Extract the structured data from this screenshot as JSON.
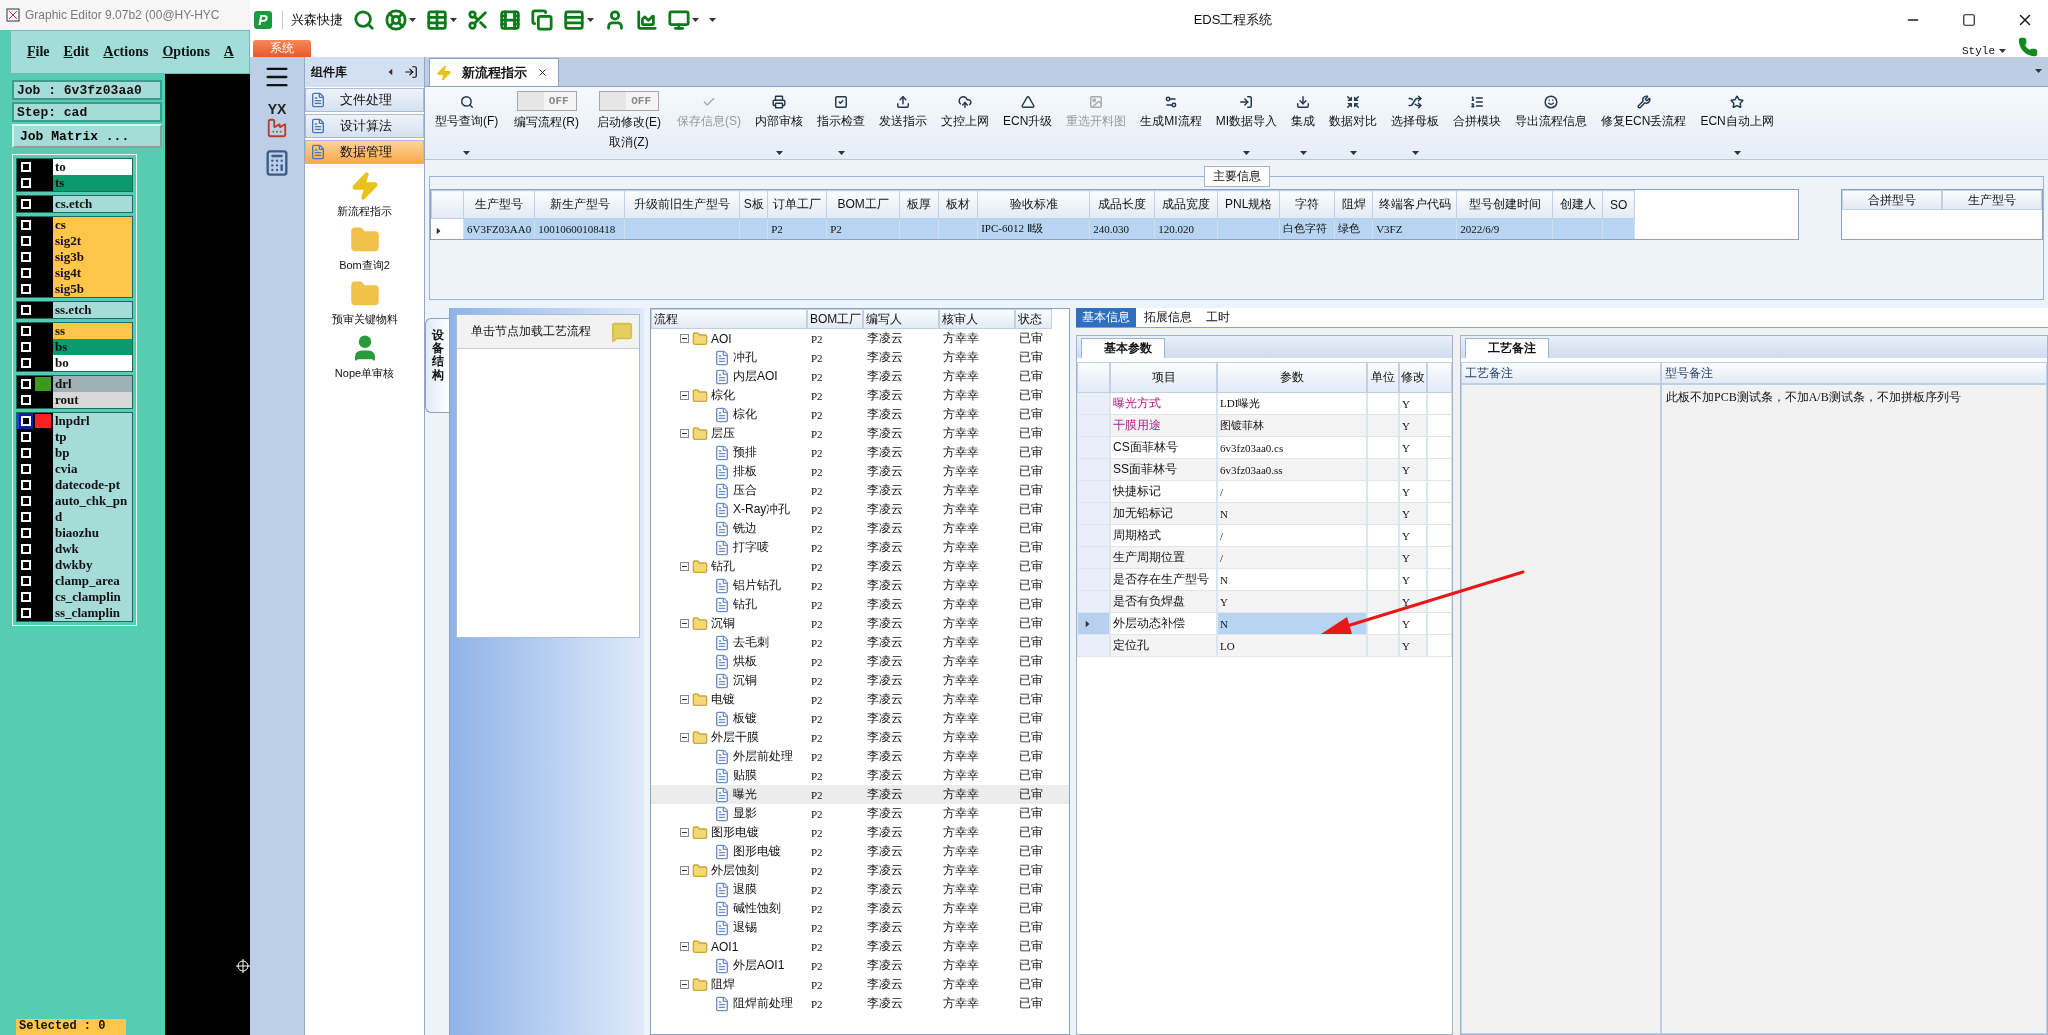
{
  "editor": {
    "title": "Graphic Editor 9.07b2 (00@HY-HYC",
    "menu": [
      "File",
      "Edit",
      "Actions",
      "Options",
      "A"
    ],
    "job": "Job : 6v3fz03aa0",
    "step": "Step: cad",
    "matrix_button": "Job Matrix ...",
    "status": "Selected : 0",
    "layer_groups": [
      [
        {
          "name": "to",
          "color": "#ffffff",
          "active": false
        },
        {
          "name": "ts",
          "color": "#0b9a6c",
          "active": false
        }
      ],
      [
        {
          "name": "cs.etch",
          "color": "#a6dcd8",
          "active": false
        }
      ],
      [
        {
          "name": "cs",
          "color": "#ffc64a",
          "active": false
        },
        {
          "name": "sig2t",
          "color": "#ffc64a",
          "active": false
        },
        {
          "name": "sig3b",
          "color": "#ffc64a",
          "active": false
        },
        {
          "name": "sig4t",
          "color": "#ffc64a",
          "active": false
        },
        {
          "name": "sig5b",
          "color": "#ffc64a",
          "active": false
        }
      ],
      [
        {
          "name": "ss.etch",
          "color": "#a6dcd8",
          "active": false
        }
      ],
      [
        {
          "name": "ss",
          "color": "#ffc64a",
          "active": false
        },
        {
          "name": "bs",
          "color": "#0b9a6c",
          "active": false
        },
        {
          "name": "bo",
          "color": "#ffffff",
          "active": false
        }
      ],
      [
        {
          "name": "drl",
          "color": "#9fb1b5",
          "marker": {
            "color": "#3c9a1c"
          },
          "active": false
        },
        {
          "name": "rout",
          "color": "#d9d9d9",
          "active": false
        }
      ],
      [
        {
          "name": "lnpdrl",
          "color": "#a6dcd8",
          "marker": {
            "color": "#ff2020"
          },
          "active": true
        },
        {
          "name": "tp",
          "color": "#a6dcd8",
          "active": false
        },
        {
          "name": "bp",
          "color": "#a6dcd8",
          "active": false
        },
        {
          "name": "cvia",
          "color": "#a6dcd8",
          "active": false
        },
        {
          "name": "datecode-pt",
          "color": "#a6dcd8",
          "active": false
        },
        {
          "name": "auto_chk_pn",
          "color": "#a6dcd8",
          "active": false
        },
        {
          "name": "d",
          "color": "#a6dcd8",
          "active": false
        },
        {
          "name": "biaozhu",
          "color": "#a6dcd8",
          "active": false
        },
        {
          "name": "dwk",
          "color": "#a6dcd8",
          "active": false
        },
        {
          "name": "dwkby",
          "color": "#a6dcd8",
          "active": false
        },
        {
          "name": "clamp_area",
          "color": "#a6dcd8",
          "active": false
        },
        {
          "name": "cs_clamplin",
          "color": "#a6dcd8",
          "active": false
        },
        {
          "name": "ss_clamplin",
          "color": "#a6dcd8",
          "active": false
        }
      ]
    ]
  },
  "app": {
    "logo": "P",
    "brand": "兴森快捷",
    "title": "EDS工程系统",
    "menu_tab": "系统",
    "style": "Style",
    "strip_logo": "YX"
  },
  "sidebar": {
    "title": "组件库",
    "sections": [
      {
        "label": "文件处理",
        "selected": false
      },
      {
        "label": "设计算法",
        "selected": false
      },
      {
        "label": "数据管理",
        "selected": true
      }
    ],
    "items": [
      {
        "label": "新流程指示",
        "kind": "flash"
      },
      {
        "label": "Bom查询2",
        "kind": "folder"
      },
      {
        "label": "预审关键物料",
        "kind": "folder"
      },
      {
        "label": "Nope单审核",
        "kind": "user"
      }
    ]
  },
  "doc_tab": {
    "label": "新流程指示"
  },
  "toolbar": [
    {
      "kind": "button",
      "label": "型号查询(F)",
      "dropdown": true,
      "disabled": false
    },
    {
      "kind": "toggle",
      "label": "编写流程(R)",
      "switch": "OFF",
      "on": false
    },
    {
      "kind": "toggle",
      "label": "启动修改(E)",
      "sublabel": "取消(Z)",
      "switch": "OFF",
      "on": false
    },
    {
      "kind": "button",
      "label": "保存信息(S)",
      "dropdown": false,
      "disabled": true
    },
    {
      "kind": "button",
      "label": "内部审核",
      "dropdown": true,
      "disabled": false
    },
    {
      "kind": "button",
      "label": "指示检查",
      "dropdown": true,
      "disabled": false
    },
    {
      "kind": "button",
      "label": "发送指示",
      "dropdown": false,
      "disabled": false
    },
    {
      "kind": "button",
      "label": "文控上网",
      "dropdown": false,
      "disabled": false
    },
    {
      "kind": "button",
      "label": "ECN升级",
      "dropdown": false,
      "disabled": false
    },
    {
      "kind": "button",
      "label": "重选开料图",
      "dropdown": false,
      "disabled": true
    },
    {
      "kind": "button",
      "label": "生成MI流程",
      "dropdown": false,
      "disabled": false
    },
    {
      "kind": "button",
      "label": "MI数据导入",
      "dropdown": true,
      "disabled": false
    },
    {
      "kind": "button",
      "label": "集成",
      "dropdown": true,
      "disabled": false
    },
    {
      "kind": "button",
      "label": "数据对比",
      "dropdown": true,
      "disabled": false
    },
    {
      "kind": "button",
      "label": "选择母板",
      "dropdown": true,
      "disabled": false
    },
    {
      "kind": "button",
      "label": "合拼模块",
      "dropdown": false,
      "disabled": false
    },
    {
      "kind": "button",
      "label": "导出流程信息",
      "dropdown": false,
      "disabled": false
    },
    {
      "kind": "button",
      "label": "修复ECN丢流程",
      "dropdown": false,
      "disabled": false
    },
    {
      "kind": "button",
      "label": "ECN自动上网",
      "dropdown": true,
      "disabled": false
    }
  ],
  "main_info": {
    "title": "主要信息",
    "row_selected": true,
    "side_columns": [
      "合拼型号",
      "生产型号"
    ],
    "columns": [
      {
        "label": "生产型号",
        "value": "6V3FZ03AA0"
      },
      {
        "label": "新生产型号",
        "value": "10010600108418"
      },
      {
        "label": "升级前旧生产型号"
      },
      {
        "label": "S板"
      },
      {
        "label": "订单工厂",
        "value": "P2"
      },
      {
        "label": "BOM工厂",
        "value": "P2"
      },
      {
        "label": "板厚"
      },
      {
        "label": "板材"
      },
      {
        "label": "验收标准",
        "value": "IPC-6012 Ⅱ级"
      },
      {
        "label": "成品长度",
        "value": "240.030"
      },
      {
        "label": "成品宽度",
        "value": "120.020"
      },
      {
        "label": "PNL规格"
      },
      {
        "label": "字符",
        "value": "白色字符"
      },
      {
        "label": "阻焊",
        "value": "绿色"
      },
      {
        "label": "终端客户代码",
        "value": "V3FZ"
      },
      {
        "label": "型号创建时间",
        "value": "2022/6/9"
      },
      {
        "label": "创建人"
      },
      {
        "label": "SO"
      }
    ]
  },
  "device_panel": {
    "tab": "设备结构",
    "hint": "单击节点加载工艺流程"
  },
  "process_tree": {
    "columns": [
      "流程",
      "BOM工厂",
      "编写人",
      "核审人",
      "状态"
    ],
    "nodes": [
      {
        "name": "AOI",
        "factory": "P2",
        "writer": "李凌云",
        "reviewer": "方幸幸",
        "status": "已审",
        "selected": false,
        "expanded": true,
        "children": [
          {
            "name": "冲孔",
            "factory": "P2",
            "writer": "李凌云",
            "reviewer": "方幸幸",
            "status": "已审",
            "selected": false
          },
          {
            "name": "内层AOI",
            "factory": "P2",
            "writer": "李凌云",
            "reviewer": "方幸幸",
            "status": "已审",
            "selected": false
          }
        ]
      },
      {
        "name": "棕化",
        "factory": "P2",
        "writer": "李凌云",
        "reviewer": "方幸幸",
        "status": "已审",
        "selected": false,
        "expanded": true,
        "children": [
          {
            "name": "棕化",
            "factory": "P2",
            "writer": "李凌云",
            "reviewer": "方幸幸",
            "status": "已审",
            "selected": false
          }
        ]
      },
      {
        "name": "层压",
        "factory": "P2",
        "writer": "李凌云",
        "reviewer": "方幸幸",
        "status": "已审",
        "selected": false,
        "expanded": true,
        "children": [
          {
            "name": "预排",
            "factory": "P2",
            "writer": "李凌云",
            "reviewer": "方幸幸",
            "status": "已审",
            "selected": false
          },
          {
            "name": "排板",
            "factory": "P2",
            "writer": "李凌云",
            "reviewer": "方幸幸",
            "status": "已审",
            "selected": false
          },
          {
            "name": "压合",
            "factory": "P2",
            "writer": "李凌云",
            "reviewer": "方幸幸",
            "status": "已审",
            "selected": false
          },
          {
            "name": "X-Ray冲孔",
            "factory": "P2",
            "writer": "李凌云",
            "reviewer": "方幸幸",
            "status": "已审",
            "selected": false
          },
          {
            "name": "铣边",
            "factory": "P2",
            "writer": "李凌云",
            "reviewer": "方幸幸",
            "status": "已审",
            "selected": false
          },
          {
            "name": "打字唛",
            "factory": "P2",
            "writer": "李凌云",
            "reviewer": "方幸幸",
            "status": "已审",
            "selected": false
          }
        ]
      },
      {
        "name": "钻孔",
        "factory": "P2",
        "writer": "李凌云",
        "reviewer": "方幸幸",
        "status": "已审",
        "selected": false,
        "expanded": true,
        "children": [
          {
            "name": "铝片钻孔",
            "factory": "P2",
            "writer": "李凌云",
            "reviewer": "方幸幸",
            "status": "已审",
            "selected": false
          },
          {
            "name": "钻孔",
            "factory": "P2",
            "writer": "李凌云",
            "reviewer": "方幸幸",
            "status": "已审",
            "selected": false
          }
        ]
      },
      {
        "name": "沉铜",
        "factory": "P2",
        "writer": "李凌云",
        "reviewer": "方幸幸",
        "status": "已审",
        "selected": false,
        "expanded": true,
        "children": [
          {
            "name": "去毛刺",
            "factory": "P2",
            "writer": "李凌云",
            "reviewer": "方幸幸",
            "status": "已审",
            "selected": false
          },
          {
            "name": "烘板",
            "factory": "P2",
            "writer": "李凌云",
            "reviewer": "方幸幸",
            "status": "已审",
            "selected": false
          },
          {
            "name": "沉铜",
            "factory": "P2",
            "writer": "李凌云",
            "reviewer": "方幸幸",
            "status": "已审",
            "selected": false
          }
        ]
      },
      {
        "name": "电镀",
        "factory": "P2",
        "writer": "李凌云",
        "reviewer": "方幸幸",
        "status": "已审",
        "selected": false,
        "expanded": true,
        "children": [
          {
            "name": "板镀",
            "factory": "P2",
            "writer": "李凌云",
            "reviewer": "方幸幸",
            "status": "已审",
            "selected": false
          }
        ]
      },
      {
        "name": "外层干膜",
        "factory": "P2",
        "writer": "李凌云",
        "reviewer": "方幸幸",
        "status": "已审",
        "selected": false,
        "expanded": true,
        "children": [
          {
            "name": "外层前处理",
            "factory": "P2",
            "writer": "李凌云",
            "reviewer": "方幸幸",
            "status": "已审",
            "selected": false
          },
          {
            "name": "贴膜",
            "factory": "P2",
            "writer": "李凌云",
            "reviewer": "方幸幸",
            "status": "已审",
            "selected": false
          },
          {
            "name": "曝光",
            "factory": "P2",
            "writer": "李凌云",
            "reviewer": "方幸幸",
            "status": "已审",
            "selected": true
          },
          {
            "name": "显影",
            "factory": "P2",
            "writer": "李凌云",
            "reviewer": "方幸幸",
            "status": "已审",
            "selected": false
          }
        ]
      },
      {
        "name": "图形电镀",
        "factory": "P2",
        "writer": "李凌云",
        "reviewer": "方幸幸",
        "status": "已审",
        "selected": false,
        "expanded": true,
        "children": [
          {
            "name": "图形电镀",
            "factory": "P2",
            "writer": "李凌云",
            "reviewer": "方幸幸",
            "status": "已审",
            "selected": false
          }
        ]
      },
      {
        "name": "外层蚀刻",
        "factory": "P2",
        "writer": "李凌云",
        "reviewer": "方幸幸",
        "status": "已审",
        "selected": false,
        "expanded": true,
        "children": [
          {
            "name": "退膜",
            "factory": "P2",
            "writer": "李凌云",
            "reviewer": "方幸幸",
            "status": "已审",
            "selected": false
          },
          {
            "name": "碱性蚀刻",
            "factory": "P2",
            "writer": "李凌云",
            "reviewer": "方幸幸",
            "status": "已审",
            "selected": false
          },
          {
            "name": "退锡",
            "factory": "P2",
            "writer": "李凌云",
            "reviewer": "方幸幸",
            "status": "已审",
            "selected": false
          }
        ]
      },
      {
        "name": "AOI1",
        "factory": "P2",
        "writer": "李凌云",
        "reviewer": "方幸幸",
        "status": "已审",
        "selected": false,
        "expanded": true,
        "children": [
          {
            "name": "外层AOI1",
            "factory": "P2",
            "writer": "李凌云",
            "reviewer": "方幸幸",
            "status": "已审",
            "selected": false
          }
        ]
      },
      {
        "name": "阻焊",
        "factory": "P2",
        "writer": "李凌云",
        "reviewer": "方幸幸",
        "status": "已审",
        "selected": false,
        "expanded": true,
        "children": [
          {
            "name": "阻焊前处理",
            "factory": "P2",
            "writer": "李凌云",
            "reviewer": "方幸幸",
            "status": "已审",
            "selected": false
          }
        ]
      }
    ]
  },
  "detail_tabs": [
    {
      "label": "基本信息",
      "selected": true
    },
    {
      "label": "拓展信息",
      "selected": false
    },
    {
      "label": "工时",
      "selected": false
    }
  ],
  "params": {
    "title": "基本参数",
    "columns": [
      "项目",
      "参数",
      "单位",
      "修改"
    ],
    "rows": [
      {
        "item": "曝光方式",
        "value": "LDI曝光",
        "modified": "Y",
        "emphasized": true,
        "selected": false
      },
      {
        "item": "干膜用途",
        "value": "图镀菲林",
        "modified": "Y",
        "emphasized": true,
        "selected": false
      },
      {
        "item": "CS面菲林号",
        "value": "6v3fz03aa0.cs",
        "modified": "Y",
        "emphasized": false,
        "selected": false
      },
      {
        "item": "SS面菲林号",
        "value": "6v3fz03aa0.ss",
        "modified": "Y",
        "emphasized": false,
        "selected": false
      },
      {
        "item": "快捷标记",
        "value": "/",
        "modified": "Y",
        "emphasized": false,
        "selected": false
      },
      {
        "item": "加无铅标记",
        "value": "N",
        "modified": "Y",
        "emphasized": false,
        "selected": false
      },
      {
        "item": "周期格式",
        "value": "/",
        "modified": "Y",
        "emphasized": false,
        "selected": false
      },
      {
        "item": "生产周期位置",
        "value": "/",
        "modified": "Y",
        "emphasized": false,
        "selected": false
      },
      {
        "item": "是否存在生产型号",
        "value": "N",
        "modified": "Y",
        "emphasized": false,
        "selected": false
      },
      {
        "item": "是否有负焊盘",
        "value": "Y",
        "modified": "Y",
        "emphasized": false,
        "selected": false
      },
      {
        "item": "外层动态补偿",
        "value": "N",
        "modified": "Y",
        "emphasized": false,
        "selected": true
      },
      {
        "item": "定位孔",
        "value": "LO",
        "modified": "Y",
        "emphasized": false,
        "selected": false
      }
    ]
  },
  "remarks": {
    "title": "工艺备注",
    "columns": [
      "工艺备注",
      "型号备注"
    ],
    "model_remark": "此板不加PCB测试条，不加A/B测试条，不加拼板序列号"
  }
}
